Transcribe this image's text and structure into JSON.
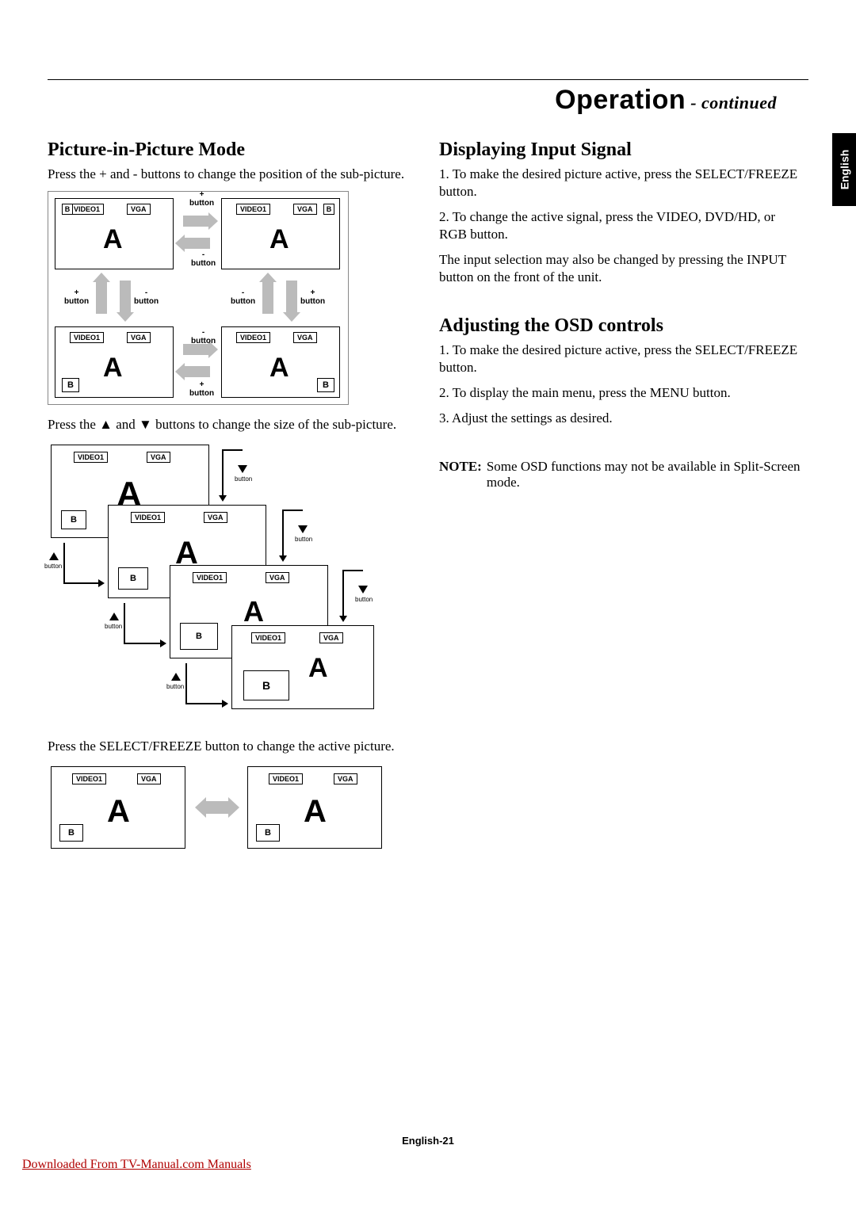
{
  "header": {
    "title": "Operation",
    "continued": " - continued"
  },
  "lang_tab": "English",
  "left": {
    "h_pip": "Picture-in-Picture Mode",
    "p_pip1": "Press the + and - buttons to change the position of the sub-picture.",
    "p_pip2": "Press the ▲ and ▼ buttons to change the size of the sub-picture.",
    "p_pip3": "Press the SELECT/FREEZE button to change the active picture."
  },
  "right": {
    "h_input": "Displaying Input Signal",
    "input_1": "1. To make the desired picture active, press the SELECT/FREEZE button.",
    "input_2": "2. To change the active signal, press the VIDEO, DVD/HD, or RGB button.",
    "input_3": "The input selection may also be changed by pressing the INPUT button on the front of the unit.",
    "h_osd": "Adjusting the OSD controls",
    "osd_1": "1. To make the desired picture active, press the SELECT/FREEZE button.",
    "osd_2": "2. To display the main menu, press the MENU button.",
    "osd_3": "3. Adjust the settings as desired.",
    "note_label": "NOTE:",
    "note_text": "Some OSD functions may not be available in Split-Screen mode."
  },
  "labels": {
    "video1": "VIDEO1",
    "vga": "VGA",
    "A": "A",
    "B": "B",
    "plus_button": "+\nbutton",
    "minus_button": "-\nbutton",
    "button": "button"
  },
  "footer": {
    "page": "English-21",
    "download": "Downloaded From TV-Manual.com Manuals"
  }
}
